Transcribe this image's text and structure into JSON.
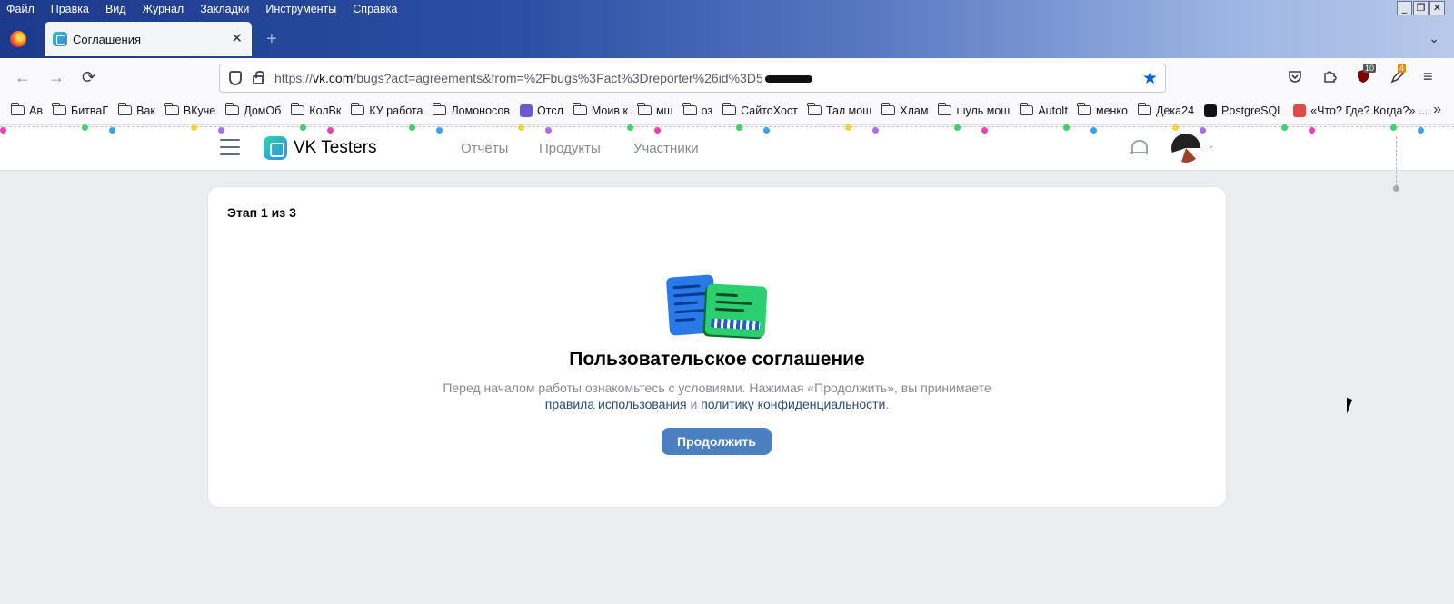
{
  "menu": [
    "Файл",
    "Правка",
    "Вид",
    "Журнал",
    "Закладки",
    "Инструменты",
    "Справка"
  ],
  "window_controls": [
    "_",
    "❐",
    "✕"
  ],
  "tab": {
    "title": "Соглашения",
    "close": "✕",
    "new": "+",
    "list": "⌄"
  },
  "nav": {
    "back": "←",
    "forward": "→",
    "reload": "⟳",
    "url_prefix": "https://",
    "url_host": "vk.com",
    "url_path": "/bugs?act=agreements&from=%2Fbugs%3Fact%3Dreporter%26id%3D5",
    "star": "★",
    "badges": {
      "ublock": "10",
      "ext": "4"
    },
    "menu": "≡"
  },
  "bookmarks": [
    {
      "label": "Ав",
      "type": "folder"
    },
    {
      "label": "БитваГ",
      "type": "folder"
    },
    {
      "label": "Вак",
      "type": "folder"
    },
    {
      "label": "ВКуче",
      "type": "folder"
    },
    {
      "label": "ДомОб",
      "type": "folder"
    },
    {
      "label": "КолВк",
      "type": "folder"
    },
    {
      "label": "КУ работа",
      "type": "folder"
    },
    {
      "label": "Ломоносов",
      "type": "folder"
    },
    {
      "label": "Отсл",
      "type": "site"
    },
    {
      "label": "Моив к",
      "type": "folder"
    },
    {
      "label": "мш",
      "type": "folder"
    },
    {
      "label": "оз",
      "type": "folder"
    },
    {
      "label": "СайтоХост",
      "type": "folder"
    },
    {
      "label": "Тал мош",
      "type": "folder"
    },
    {
      "label": "Хлам",
      "type": "folder"
    },
    {
      "label": "шуль мош",
      "type": "folder"
    },
    {
      "label": "AutoIt",
      "type": "folder"
    },
    {
      "label": "менко",
      "type": "folder"
    },
    {
      "label": "Дека24",
      "type": "folder"
    },
    {
      "label": "PostgreSQL",
      "type": "site-dark"
    },
    {
      "label": "«Что? Где? Когда?» ...",
      "type": "site-red"
    }
  ],
  "bookmarks_more": "»",
  "vk": {
    "brand": "VK Testers",
    "nav": [
      "Отчёты",
      "Продукты",
      "Участники"
    ],
    "avatar_chevron": "⌄"
  },
  "card": {
    "step": "Этап 1 из 3",
    "title": "Пользовательское соглашение",
    "desc_before": "Перед началом работы ознакомьтесь с условиями. Нажимая «Продолжить», вы принимаете",
    "link_rules": "правила использования",
    "and": " и ",
    "link_privacy": "политику конфиденциальности",
    "period": ".",
    "button": "Продолжить"
  },
  "colors": {
    "accent": "#4a7fc1",
    "link": "#2c4b72",
    "muted": "#818c99",
    "page_bg": "#ebedf0"
  }
}
